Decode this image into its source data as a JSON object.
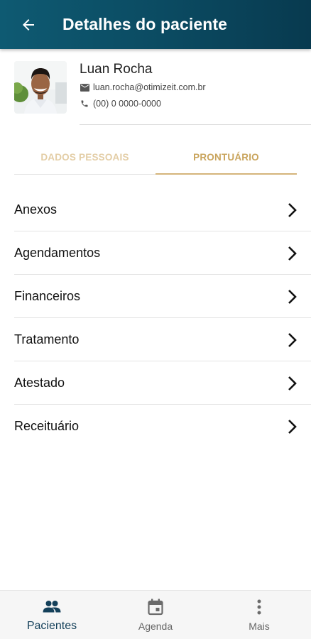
{
  "header": {
    "title": "Detalhes do paciente",
    "back_icon": "arrow-left-icon"
  },
  "patient": {
    "name": "Luan Rocha",
    "email": "luan.rocha@otimizeit.com.br",
    "phone": "(00) 0 0000-0000"
  },
  "tabs": [
    {
      "label": "DADOS PESSOAIS",
      "active": false
    },
    {
      "label": "PRONTUÁRIO",
      "active": true
    }
  ],
  "menu": [
    {
      "label": "Anexos"
    },
    {
      "label": "Agendamentos"
    },
    {
      "label": "Financeiros"
    },
    {
      "label": "Tratamento"
    },
    {
      "label": "Atestado"
    },
    {
      "label": "Receituário"
    }
  ],
  "bottom_nav": [
    {
      "label": "Pacientes",
      "icon": "people-icon",
      "active": true
    },
    {
      "label": "Agenda",
      "icon": "calendar-icon",
      "active": false
    },
    {
      "label": "Mais",
      "icon": "more-vertical-icon",
      "active": false
    }
  ],
  "colors": {
    "appbar": "#0b4a61",
    "tab_active": "#c9a45c",
    "tab_inactive": "#e3cda5",
    "nav_active": "#14405a"
  }
}
